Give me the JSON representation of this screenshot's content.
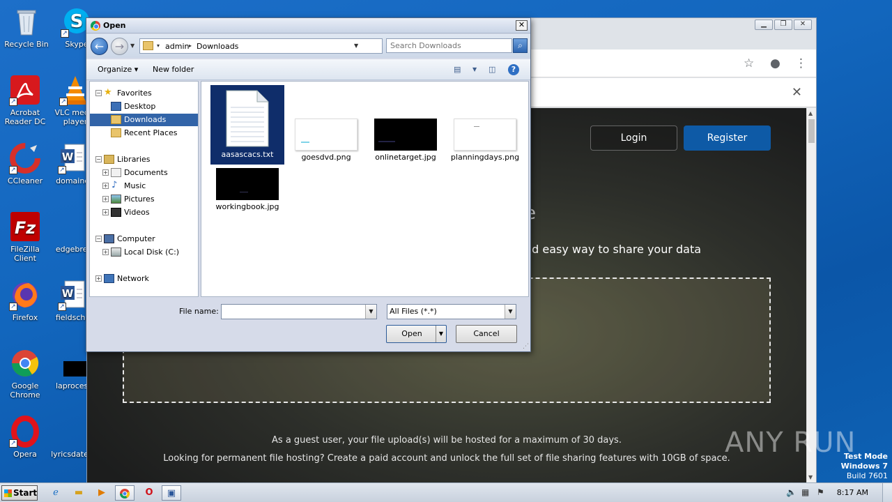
{
  "desktop": {
    "icons": [
      {
        "label": "Recycle Bin"
      },
      {
        "label": "Skype"
      },
      {
        "label": "Acrobat Reader DC"
      },
      {
        "label": "VLC media player"
      },
      {
        "label": "CCleaner"
      },
      {
        "label": "domaincr"
      },
      {
        "label": "FileZilla Client"
      },
      {
        "label": "edgebrea"
      },
      {
        "label": "Firefox"
      },
      {
        "label": "fieldschoi"
      },
      {
        "label": "Google Chrome"
      },
      {
        "label": "laprocess"
      },
      {
        "label": "Opera"
      },
      {
        "label": "lyricsdate"
      }
    ]
  },
  "browser": {
    "window_controls": [
      "minimize",
      "restore",
      "close"
    ],
    "webpage": {
      "login_label": "Login",
      "register_label": "Register",
      "partial_heading": "e",
      "tagline": "nd easy way to share your data",
      "note1": "As a guest user, your file upload(s) will be hosted for a maximum of 30 days.",
      "note2": "Looking for permanent file hosting? Create a paid account and unlock the full set of file sharing features with 10GB of space."
    }
  },
  "dialog": {
    "title": "Open",
    "path": [
      "admin",
      "Downloads"
    ],
    "search_placeholder": "Search Downloads",
    "toolbar": {
      "organize": "Organize",
      "new_folder": "New folder"
    },
    "tree": {
      "favorites": "Favorites",
      "desktop": "Desktop",
      "downloads": "Downloads",
      "recent": "Recent Places",
      "libraries": "Libraries",
      "documents": "Documents",
      "music": "Music",
      "pictures": "Pictures",
      "videos": "Videos",
      "computer": "Computer",
      "local_disk": "Local Disk (C:)",
      "network": "Network"
    },
    "files": [
      {
        "name": "aasascacs.txt",
        "type": "txt",
        "selected": true
      },
      {
        "name": "goesdvd.png",
        "type": "png",
        "selected": false
      },
      {
        "name": "onlinetarget.jpg",
        "type": "jpg",
        "selected": false
      },
      {
        "name": "planningdays.png",
        "type": "png",
        "selected": false
      },
      {
        "name": "workingbook.jpg",
        "type": "jpg",
        "selected": false
      }
    ],
    "file_name_label": "File name:",
    "file_name_value": "",
    "file_type": "All Files (*.*)",
    "open_label": "Open",
    "cancel_label": "Cancel"
  },
  "taskbar": {
    "start_label": "Start",
    "clock": "8:17 AM"
  },
  "watermark": {
    "brand": "ANY RUN",
    "test_mode": "Test Mode",
    "os": "Windows 7",
    "build": "Build 7601"
  }
}
